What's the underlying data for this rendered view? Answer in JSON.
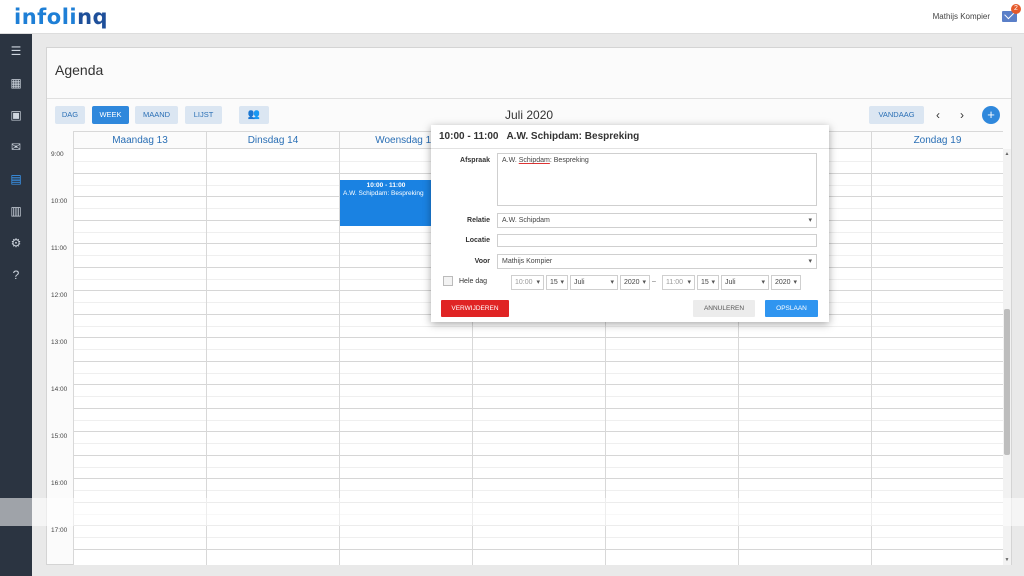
{
  "header": {
    "logo_text_1": "infoli",
    "logo_text_2": "nq",
    "user_name": "Mathijs Kompier",
    "mail_badge": "2"
  },
  "sidebar": {
    "items": [
      {
        "icon": "menu-icon",
        "glyph": "☰"
      },
      {
        "icon": "dashboard-icon",
        "glyph": "▦"
      },
      {
        "icon": "contacts-icon",
        "glyph": "▣"
      },
      {
        "icon": "mail-icon",
        "glyph": "✉"
      },
      {
        "icon": "calendar-icon",
        "glyph": "▤"
      },
      {
        "icon": "clipboard-icon",
        "glyph": "▥"
      },
      {
        "icon": "settings-icon",
        "glyph": "⚙"
      },
      {
        "icon": "help-icon",
        "glyph": "?"
      }
    ]
  },
  "page": {
    "title": "Agenda"
  },
  "toolbar": {
    "tabs": [
      "DAG",
      "WEEK",
      "MAAND",
      "LIJST"
    ],
    "active_tab": "WEEK",
    "people_icon": "👥",
    "month": "Juli 2020",
    "today": "VANDAAG",
    "prev": "‹",
    "next": "›",
    "add": "+"
  },
  "calendar": {
    "days": [
      "Maandag 13",
      "Dinsdag 14",
      "Woensdag 15",
      "",
      "",
      "",
      "Zondag 19"
    ],
    "times": [
      "9:00",
      "10:00",
      "11:00",
      "12:00",
      "13:00",
      "14:00",
      "15:00",
      "16:00",
      "17:00"
    ],
    "event": {
      "time": "10:00 - 11:00",
      "title": "A.W. Schipdam: Bespreking"
    }
  },
  "modal": {
    "title": "10:00 - 11:00   A.W. Schipdam: Bespreking",
    "afspraak_label": "Afspraak",
    "afspraak_prefix": "A.W. ",
    "afspraak_spell": "Schipdam",
    "afspraak_suffix": ": Bespreking",
    "relatie_label": "Relatie",
    "relatie_value": "A.W. Schipdam",
    "locatie_label": "Locatie",
    "locatie_value": "",
    "voor_label": "Voor",
    "voor_value": "Mathijs Kompier",
    "hele_dag_label": "Hele dag",
    "start_time": "10:00",
    "start_day": "15",
    "start_month": "Juli",
    "start_year": "2020",
    "dash": "–",
    "end_time": "11:00",
    "end_day": "15",
    "end_month": "Juli",
    "end_year": "2020",
    "delete_label": "VERWIJDEREN",
    "cancel_label": "ANNULEREN",
    "save_label": "OPSLAAN"
  }
}
